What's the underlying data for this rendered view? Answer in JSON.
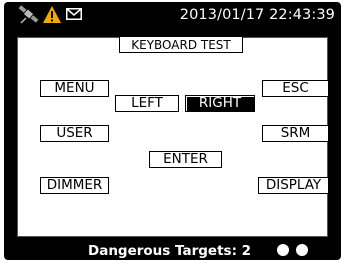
{
  "status": {
    "timestamp": "2013/01/17 22:43:39",
    "icons": [
      "satellite-icon",
      "warning-icon",
      "mail-icon"
    ],
    "warning_color": "#f5a800"
  },
  "panel": {
    "title": "KEYBOARD TEST",
    "keys": {
      "menu": "MENU",
      "esc": "ESC",
      "left": "LEFT",
      "right": "RIGHT",
      "user": "USER",
      "srm": "SRM",
      "enter": "ENTER",
      "dimmer": "DIMMER",
      "display": "DISPLAY"
    },
    "active_key": "right"
  },
  "footer": {
    "label": "Dangerous Targets:",
    "count": "2",
    "indicators": 2
  }
}
